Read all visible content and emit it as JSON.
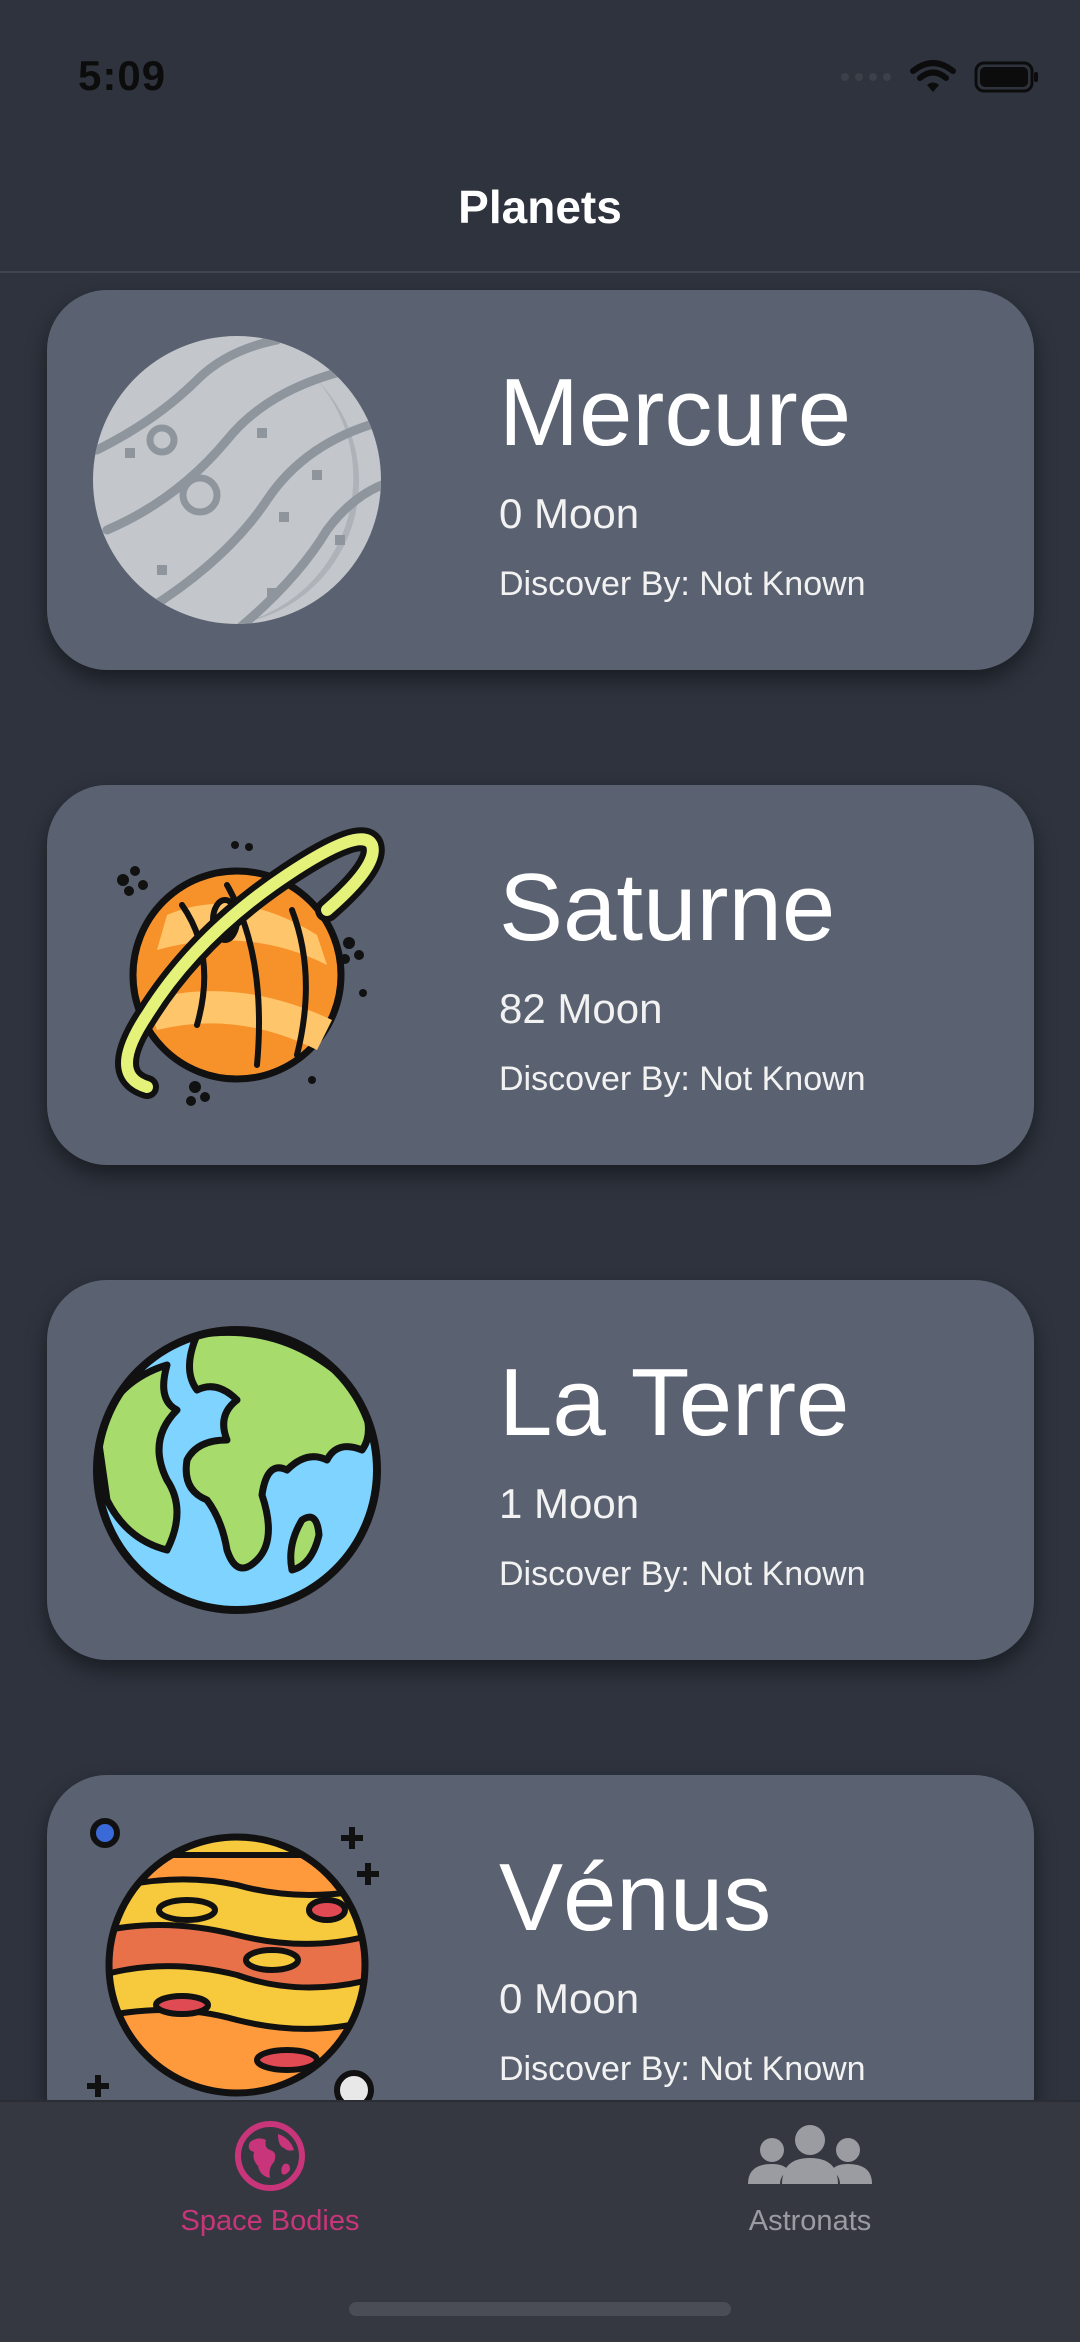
{
  "status_bar": {
    "time": "5:09"
  },
  "nav": {
    "title": "Planets"
  },
  "planets": [
    {
      "name": "Mercure",
      "moons": "0 Moon",
      "discover": "Discover By: Not Known",
      "icon": "mercury-planet-icon"
    },
    {
      "name": "Saturne",
      "moons": "82 Moon",
      "discover": "Discover By: Not Known",
      "icon": "saturn-planet-icon"
    },
    {
      "name": "La Terre",
      "moons": "1 Moon",
      "discover": "Discover By: Not Known",
      "icon": "earth-planet-icon"
    },
    {
      "name": "Vénus",
      "moons": "0 Moon",
      "discover": "Discover By: Not Known",
      "icon": "venus-planet-icon"
    }
  ],
  "tabs": [
    {
      "label": "Space Bodies",
      "icon": "globe-icon",
      "active": true
    },
    {
      "label": "Astronats",
      "icon": "people-icon",
      "active": false
    }
  ],
  "colors": {
    "background": "#2e333e",
    "card": "#5a6170",
    "tab_active": "#c8357a",
    "tab_inactive": "#9a9ca1"
  }
}
